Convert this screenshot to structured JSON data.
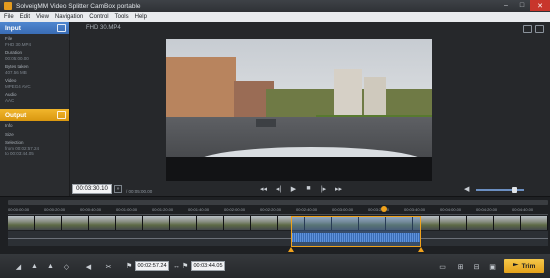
{
  "window": {
    "title": "SolveigMM Video Splitter CamBox portable"
  },
  "menu": [
    "File",
    "Edit",
    "View",
    "Navigation",
    "Control",
    "Tools",
    "Help"
  ],
  "input_panel": {
    "title": "Input",
    "fields": [
      {
        "label": "File",
        "value": "FHD 30.MP4"
      },
      {
        "label": "Duration",
        "value": "00:05:00.00"
      },
      {
        "label": "Bytes taken",
        "value": "407.56 MB"
      },
      {
        "label": "Video",
        "value": "MPEG4 AVC"
      },
      {
        "label": "Audio",
        "value": "AAC"
      }
    ]
  },
  "output_panel": {
    "title": "Output",
    "fields": [
      {
        "label": "Info",
        "value": ""
      },
      {
        "label": "Size",
        "value": ""
      },
      {
        "label": "Selection",
        "value": "from 00:02:57.24"
      },
      {
        "label": "",
        "value": "to 00:03:44.05"
      }
    ]
  },
  "preview": {
    "file_name": "FHD 30.MP4",
    "current_time": "00:03:30.10",
    "duration": "00:05:00.00",
    "volume_level": 0.8
  },
  "timeline": {
    "ruler": [
      "00:00:00.00",
      "00:00:20.00",
      "00:00:40.00",
      "00:01:00.00",
      "00:01:20.00",
      "00:01:40.00",
      "00:02:00.00",
      "00:02:20.00",
      "00:02:40.00",
      "00:03:00.00",
      "00:03:20.00",
      "00:03:40.00",
      "00:04:00.00",
      "00:04:20.00",
      "00:04:40.00"
    ],
    "thumb_count": 20
  },
  "bottom": {
    "start_time": "00:02:57.24",
    "end_time": "00:03:44.05",
    "trim_label": "Trim"
  }
}
